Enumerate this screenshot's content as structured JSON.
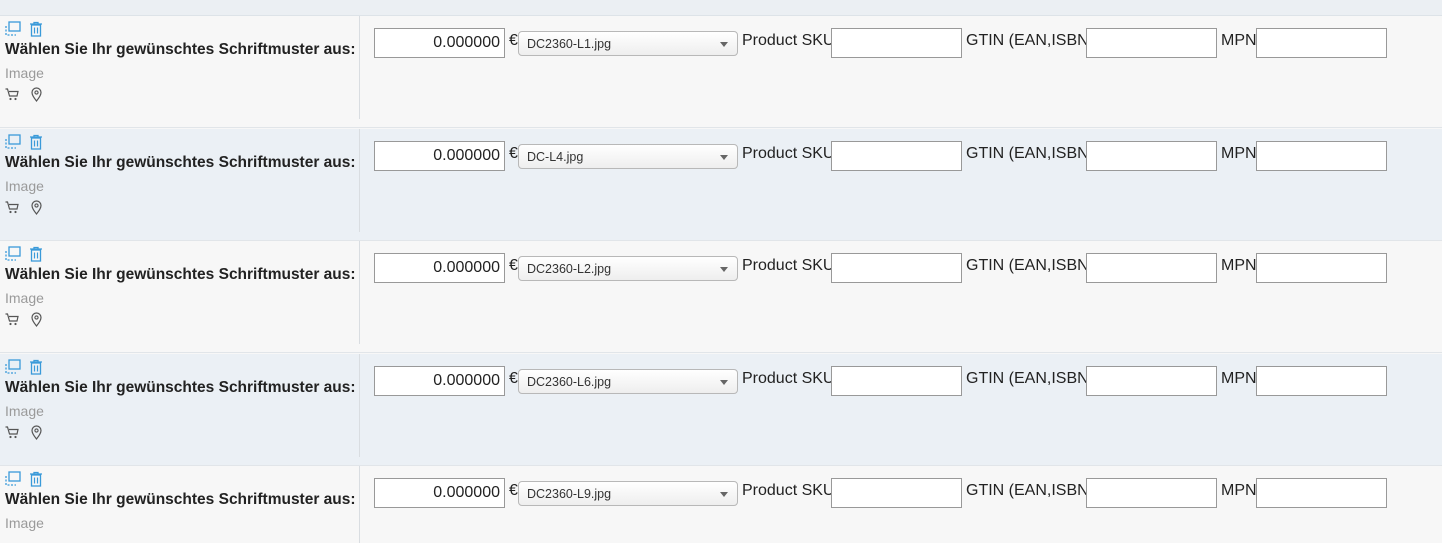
{
  "rows": [
    {
      "option_name": "Wählen Sie Ihr gewünschtes Schriftmuster aus:",
      "option_type": "Image",
      "price": "0.000000",
      "currency": "€",
      "image_file": "DC2360-L1.jpg",
      "sku_label": "Product SKU",
      "sku_value": "",
      "gtin_label": "GTIN (EAN,ISBN)",
      "gtin_value": "",
      "mpn_label": "MPN",
      "mpn_value": ""
    },
    {
      "option_name": "Wählen Sie Ihr gewünschtes Schriftmuster aus:",
      "option_type": "Image",
      "price": "0.000000",
      "currency": "€",
      "image_file": "DC-L4.jpg",
      "sku_label": "Product SKU",
      "sku_value": "",
      "gtin_label": "GTIN (EAN,ISBN)",
      "gtin_value": "",
      "mpn_label": "MPN",
      "mpn_value": ""
    },
    {
      "option_name": "Wählen Sie Ihr gewünschtes Schriftmuster aus:",
      "option_type": "Image",
      "price": "0.000000",
      "currency": "€",
      "image_file": "DC2360-L2.jpg",
      "sku_label": "Product SKU",
      "sku_value": "",
      "gtin_label": "GTIN (EAN,ISBN)",
      "gtin_value": "",
      "mpn_label": "MPN",
      "mpn_value": ""
    },
    {
      "option_name": "Wählen Sie Ihr gewünschtes Schriftmuster aus:",
      "option_type": "Image",
      "price": "0.000000",
      "currency": "€",
      "image_file": "DC2360-L6.jpg",
      "sku_label": "Product SKU",
      "sku_value": "",
      "gtin_label": "GTIN (EAN,ISBN)",
      "gtin_value": "",
      "mpn_label": "MPN",
      "mpn_value": ""
    },
    {
      "option_name": "Wählen Sie Ihr gewünschtes Schriftmuster aus:",
      "option_type": "Image",
      "price": "0.000000",
      "currency": "€",
      "image_file": "DC2360-L9.jpg",
      "sku_label": "Product SKU",
      "sku_value": "",
      "gtin_label": "GTIN (EAN,ISBN)",
      "gtin_value": "",
      "mpn_label": "MPN",
      "mpn_value": ""
    }
  ],
  "icons": {
    "copy": "copy-icon",
    "delete": "trash-icon",
    "cart": "cart-icon",
    "location": "map-pin-icon"
  },
  "colors": {
    "accent_icon": "#3a9ad9",
    "row_alt": "#ebf0f5",
    "row_plain": "#f7f7f7"
  }
}
